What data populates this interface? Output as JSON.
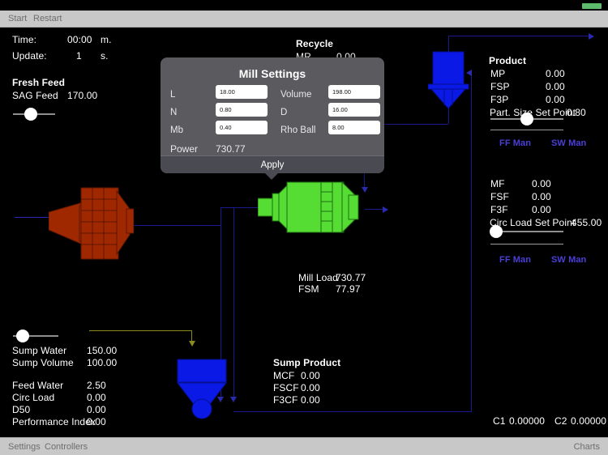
{
  "toolbar": {
    "start_label": "Start",
    "restart_label": "Restart"
  },
  "bottombar": {
    "settings_label": "Settings",
    "controllers_label": "Controllers",
    "charts_label": "Charts"
  },
  "status": {
    "time_label": "Time:",
    "time_value": "00:00",
    "time_unit": "m.",
    "update_label": "Update:",
    "update_value": "1",
    "update_unit": "s."
  },
  "fresh_feed": {
    "title": "Fresh Feed",
    "sag_feed_label": "SAG  Feed",
    "sag_feed_value": "170.00"
  },
  "recycle": {
    "title": "Recycle",
    "mr_label": "MR",
    "mr_value": "0.00"
  },
  "product": {
    "title": "Product",
    "rows": [
      {
        "label": "MP",
        "value": "0.00"
      },
      {
        "label": "FSP",
        "value": "0.00"
      },
      {
        "label": "F3P",
        "value": "0.00"
      }
    ],
    "setpoint_label": "Part. Size Set Point",
    "setpoint_value": "0.80",
    "ff_man_label": "FF Man",
    "sw_man_label": "SW Man"
  },
  "feed": {
    "rows": [
      {
        "label": "MF",
        "value": "0.00"
      },
      {
        "label": "FSF",
        "value": "0.00"
      },
      {
        "label": "F3F",
        "value": "0.00"
      }
    ],
    "setpoint_label": "Circ Load Set Point",
    "setpoint_value": "455.00",
    "ff_man_label": "FF Man",
    "sw_man_label": "SW Man"
  },
  "mill": {
    "load_label": "Mill Load",
    "load_value": "730.77",
    "fsm_label": "FSM",
    "fsm_value": "77.97"
  },
  "sump_product": {
    "title": "Sump Product",
    "rows": [
      {
        "label": "MCF",
        "value": "0.00"
      },
      {
        "label": "FSCF",
        "value": "0.00"
      },
      {
        "label": "F3CF",
        "value": "0.00"
      }
    ]
  },
  "sump": {
    "water_label": "Sump Water",
    "water_value": "150.00",
    "volume_label": "Sump Volume",
    "volume_value": "100.00"
  },
  "stats": {
    "rows": [
      {
        "label": "Feed Water",
        "value": "2.50"
      },
      {
        "label": "Circ Load",
        "value": "0.00"
      },
      {
        "label": "D50",
        "value": "0.00"
      },
      {
        "label": "Performance Index",
        "value": "0.00"
      }
    ]
  },
  "controllers": {
    "c1_label": "C1",
    "c1_value": "0.00000",
    "c2_label": "C2",
    "c2_value": "0.00000"
  },
  "mill_settings": {
    "title": "Mill Settings",
    "fields": [
      {
        "label": "L",
        "value": "18.00"
      },
      {
        "label": "N",
        "value": "0.80"
      },
      {
        "label": "Mb",
        "value": "0.40"
      },
      {
        "label": "Volume",
        "value": "198.00"
      },
      {
        "label": "D",
        "value": "16.00"
      },
      {
        "label": "Rho Ball",
        "value": "8.00"
      }
    ],
    "power_label": "Power",
    "power_value": "730.77",
    "apply_label": "Apply"
  },
  "colors": {
    "sag_mill": "#a02800",
    "ball_mill": "#55dd33",
    "cyclone": "#0a19e6",
    "pipe": "#1a1a8c",
    "water_pipe": "#8c8c1e",
    "accent_blue": "#4b3fd8",
    "chrome": "#c8c8c8",
    "battery": "#5dbb6b"
  }
}
